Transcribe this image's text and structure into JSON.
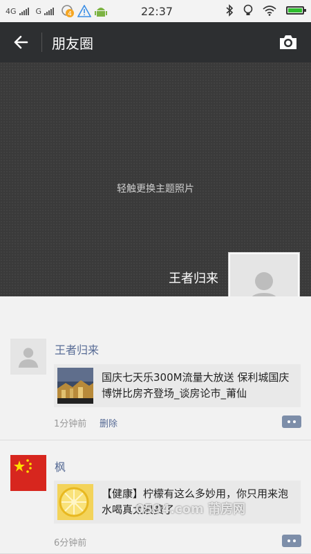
{
  "status_bar": {
    "net1": "4G",
    "net2": "G",
    "notif_count": "4",
    "time": "22:37"
  },
  "header": {
    "title": "朋友圈"
  },
  "cover": {
    "hint": "轻触更换主题照片",
    "user_name": "王者归来"
  },
  "posts": [
    {
      "author": "王者归来",
      "link_text": "国庆七天乐300M流量大放送 保利城国庆博饼比房齐登场_谈房论市_莆仙",
      "time": "1分钟前",
      "delete_label": "删除"
    },
    {
      "author": "枫",
      "link_text": "【健康】柠檬有这么多妙用，你只用来泡水喝真太浪费了",
      "time": "6分钟前"
    }
  ],
  "watermark": "0594.com 莆房网",
  "colors": {
    "topbar": "#2d2f31",
    "name_link": "#576b95",
    "battery": "#2ebd2e"
  }
}
